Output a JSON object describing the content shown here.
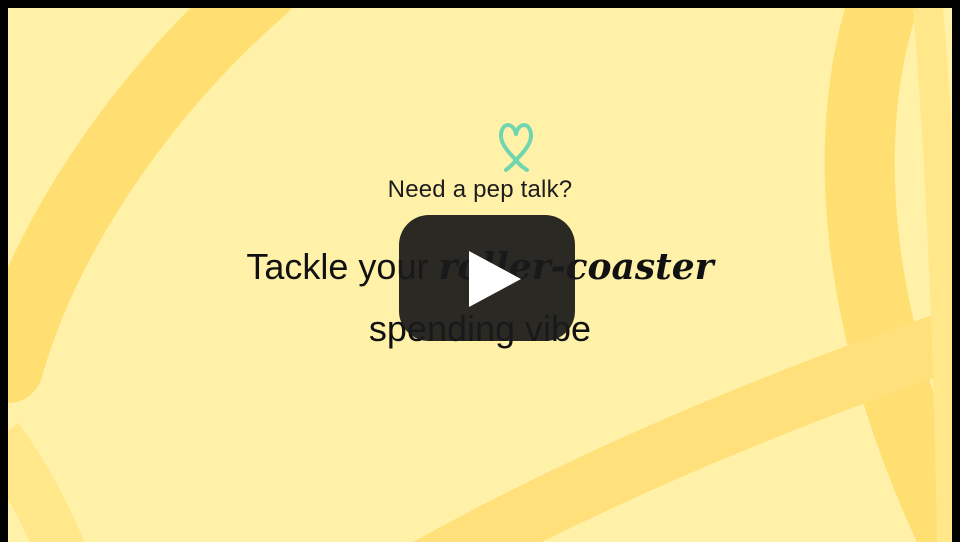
{
  "video": {
    "title": "Need a pep talk?",
    "headline_line1_part1": "Tackle your ",
    "headline_line1_part2": "roller-coaster",
    "headline_line2": "spending vibe",
    "accent_color": "#6FD6B0",
    "background_color": "#FFF1A8",
    "stroke_color": "#FFDF72",
    "icon": "heart-icon"
  },
  "player": {
    "play_button_label": "Play",
    "play_button_color": "#1a1a1a"
  }
}
